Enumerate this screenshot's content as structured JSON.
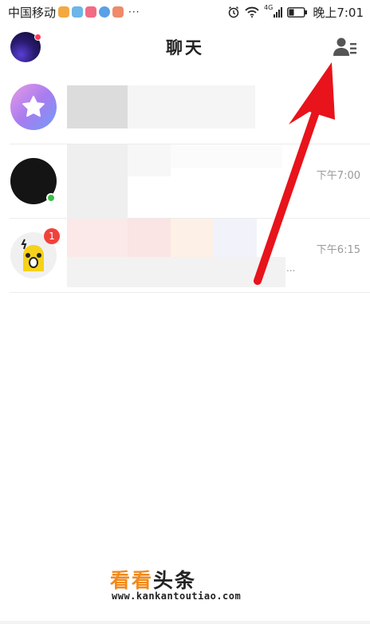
{
  "status_bar": {
    "carrier": "中国移动",
    "more": "···",
    "network": "4G",
    "time": "晚上7:01",
    "app_icon_colors": [
      "#f3a940",
      "#6cb6e8",
      "#f26a83",
      "#5aa0e6",
      "#f08a6a"
    ]
  },
  "header": {
    "title": "聊天"
  },
  "chats": [
    {
      "time": "",
      "unread": "",
      "online": false,
      "avatar": "star-avatar"
    },
    {
      "time": "下午7:00",
      "unread": "",
      "online": true,
      "avatar": "dark-avatar"
    },
    {
      "time": "下午6:15",
      "unread": "1",
      "online": false,
      "avatar": "robot-avatar",
      "preview_tail": "..."
    }
  ],
  "watermark": {
    "part1": "看看",
    "part2": "头条",
    "url": "www.kankantoutiao.com"
  },
  "colors": {
    "accent_red": "#f2413c",
    "online_green": "#3bbf48",
    "arrow_red": "#e8131b",
    "watermark_orange": "#f28a1c"
  }
}
